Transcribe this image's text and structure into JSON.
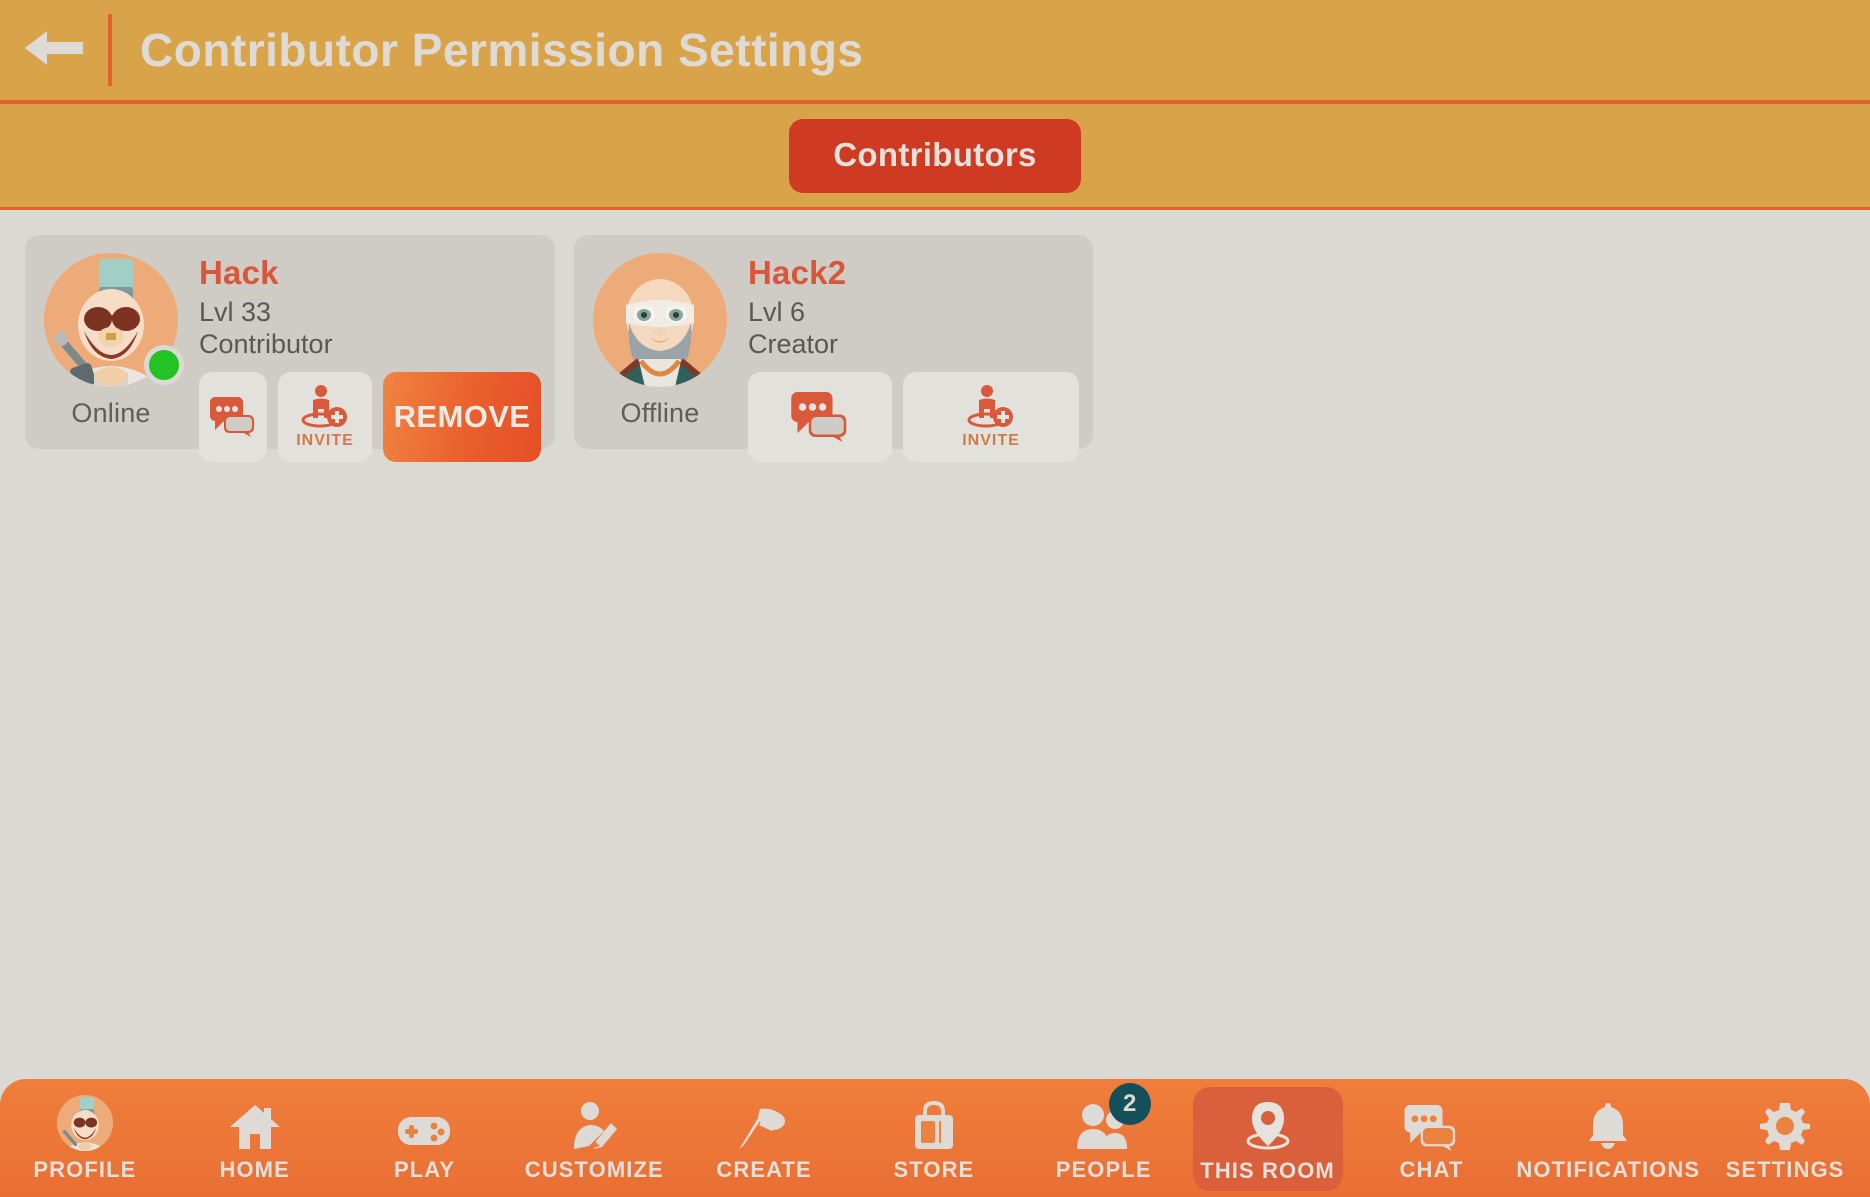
{
  "header": {
    "back_icon": "back-arrow-icon",
    "title": "Contributor Permission Settings",
    "background_color": "#d9a349",
    "title_color": "#dedbd6",
    "accent_color": "#e2622c"
  },
  "tabs": {
    "items": [
      {
        "label": "Contributors",
        "active": true,
        "color": "#cf3a22"
      }
    ]
  },
  "contributors": [
    {
      "name": "Hack",
      "level": "Lvl 33",
      "role": "Contributor",
      "status": "Online",
      "status_color": "#22c322",
      "online": true,
      "actions": [
        {
          "type": "chat",
          "icon": "chat-bubbles-icon",
          "label": ""
        },
        {
          "type": "invite",
          "icon": "invite-person-icon",
          "label": "INVITE"
        },
        {
          "type": "remove",
          "icon": "",
          "label": "REMOVE"
        }
      ]
    },
    {
      "name": "Hack2",
      "level": "Lvl 6",
      "role": "Creator",
      "status": "Offline",
      "status_color": "",
      "online": false,
      "actions": [
        {
          "type": "chat",
          "icon": "chat-bubbles-icon",
          "label": ""
        },
        {
          "type": "invite",
          "icon": "invite-person-icon",
          "label": "INVITE"
        }
      ]
    }
  ],
  "bottom_nav": {
    "background_color": "#ef7e3c",
    "active_color": "#d9603a",
    "items": [
      {
        "label": "PROFILE",
        "icon": "profile-avatar-icon",
        "active": false,
        "badge": ""
      },
      {
        "label": "HOME",
        "icon": "house-icon",
        "active": false,
        "badge": ""
      },
      {
        "label": "PLAY",
        "icon": "gamepad-icon",
        "active": false,
        "badge": ""
      },
      {
        "label": "CUSTOMIZE",
        "icon": "person-pencil-icon",
        "active": false,
        "badge": ""
      },
      {
        "label": "CREATE",
        "icon": "hammer-icon",
        "active": false,
        "badge": ""
      },
      {
        "label": "STORE",
        "icon": "shopping-bag-icon",
        "active": false,
        "badge": ""
      },
      {
        "label": "PEOPLE",
        "icon": "people-group-icon",
        "active": false,
        "badge": "2"
      },
      {
        "label": "THIS ROOM",
        "icon": "location-pin-icon",
        "active": true,
        "badge": ""
      },
      {
        "label": "CHAT",
        "icon": "chat-bubbles-icon",
        "active": false,
        "badge": ""
      },
      {
        "label": "NOTIFICATIONS",
        "icon": "bell-icon",
        "active": false,
        "badge": ""
      },
      {
        "label": "SETTINGS",
        "icon": "gear-icon",
        "active": false,
        "badge": ""
      }
    ]
  }
}
